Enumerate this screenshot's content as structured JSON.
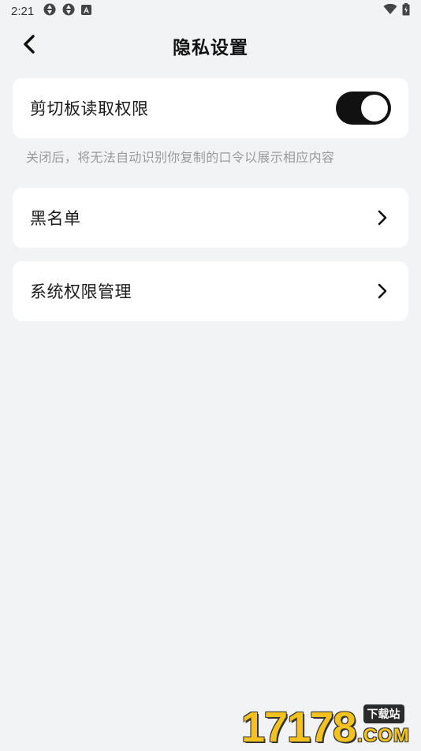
{
  "status_bar": {
    "time": "2:21",
    "left_icons": [
      "aperture-icon",
      "aperture-icon",
      "a-box-icon"
    ],
    "right_icons": [
      "wifi-icon",
      "battery-icon"
    ]
  },
  "header": {
    "title": "隐私设置",
    "back_icon": "chevron-left-icon"
  },
  "settings": {
    "clipboard": {
      "label": "剪切板读取权限",
      "toggle_on": true,
      "hint": "关闭后，将无法自动识别你复制的口令以展示相应内容"
    },
    "blacklist": {
      "label": "黑名单",
      "icon": "chevron-right-icon"
    },
    "system_permissions": {
      "label": "系统权限管理",
      "icon": "chevron-right-icon"
    }
  },
  "watermark": {
    "number": "17178",
    "badge": "下载站",
    "suffix": ".COM"
  },
  "colors": {
    "background": "#f2f3f4",
    "card": "#ffffff",
    "toggle_on": "#111111",
    "hint": "#9a9a9a",
    "watermark_yellow": "#f4c21f"
  }
}
